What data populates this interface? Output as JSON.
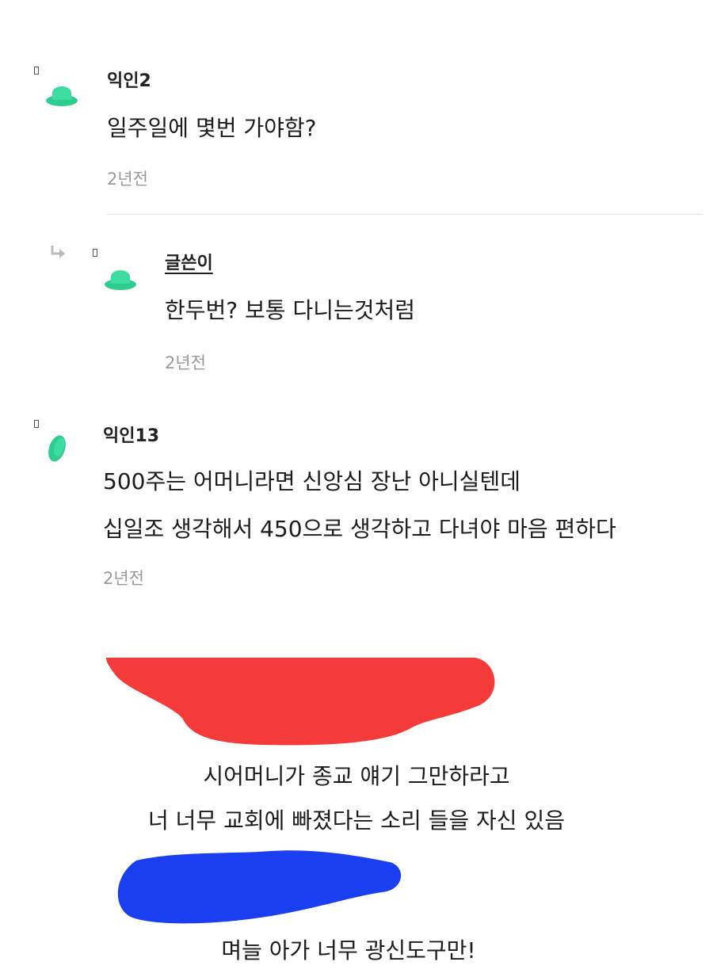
{
  "comments": [
    {
      "nickname": "익인2",
      "lines": [
        "일주일에 몇번 가야함?"
      ],
      "time": "2년전"
    },
    {
      "nickname": "글쓴이",
      "is_reply": true,
      "is_author": true,
      "lines": [
        "한두번? 보통 다니는것처럼"
      ],
      "time": "2년전"
    },
    {
      "nickname": "익인13",
      "lines": [
        "500주는 어머니라면 신앙심 장난 아니실텐데",
        "십일조 생각해서 450으로 생각하고 다녀야 마음 편하다"
      ],
      "time": "2년전"
    }
  ],
  "annotation": {
    "red_caption_lines": [
      "시어머니가 종교 얘기 그만하라고",
      "너 너무 교회에 빠졌다는 소리 들을 자신 있음"
    ],
    "blue_caption": "며늘 아가 너무 광신도구만!",
    "red_color": "#f53a3a",
    "blue_color": "#1a3ff0"
  },
  "avatar_color": "#2ecc8f",
  "icons": {
    "reply": "reply-arrow-icon",
    "box": "missing-glyph-icon"
  }
}
